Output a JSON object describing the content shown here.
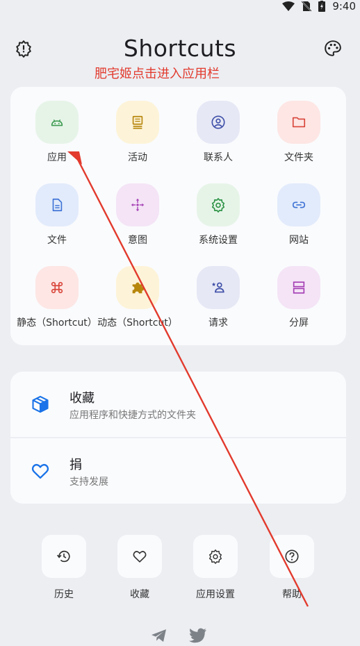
{
  "status_bar": {
    "time": "9:40"
  },
  "header": {
    "title": "Shortcuts"
  },
  "annotation": {
    "text": "肥宅姬点击进入应用栏"
  },
  "grid": {
    "items": [
      {
        "label": "应用",
        "icon": "android-icon",
        "bg": "#e6f4e8",
        "color": "#3d9a50"
      },
      {
        "label": "活动",
        "icon": "activity-icon",
        "bg": "#fdf3d8",
        "color": "#b7860b"
      },
      {
        "label": "联系人",
        "icon": "contact-icon",
        "bg": "#e6e8f5",
        "color": "#3f4fa8"
      },
      {
        "label": "文件夹",
        "icon": "folder-icon",
        "bg": "#fde6e4",
        "color": "#d9453a"
      },
      {
        "label": "文件",
        "icon": "file-icon",
        "bg": "#e2ebfb",
        "color": "#3f73d6"
      },
      {
        "label": "意图",
        "icon": "intent-icon",
        "bg": "#f4e4f6",
        "color": "#a43cb3"
      },
      {
        "label": "系统设置",
        "icon": "settings-icon",
        "bg": "#e6f4e8",
        "color": "#2f9447"
      },
      {
        "label": "网站",
        "icon": "link-icon",
        "bg": "#e2ebfb",
        "color": "#3f73d6"
      },
      {
        "label": "静态（Shortcut）",
        "icon": "command-icon",
        "bg": "#fde6e4",
        "color": "#d9453a"
      },
      {
        "label": "动态（Shortcut）",
        "icon": "puzzle-icon",
        "bg": "#fdf3d8",
        "color": "#b7860b"
      },
      {
        "label": "请求",
        "icon": "person-star-icon",
        "bg": "#e6e8f5",
        "color": "#3f4fa8"
      },
      {
        "label": "分屏",
        "icon": "split-screen-icon",
        "bg": "#f4e4f6",
        "color": "#a43cb3"
      }
    ]
  },
  "list": {
    "favorites": {
      "title": "收藏",
      "subtitle": "应用程序和快捷方式的文件夹",
      "icon": "box-icon"
    },
    "donate": {
      "title": "捐",
      "subtitle": "支持发展",
      "icon": "heart-icon"
    }
  },
  "bottom_nav": {
    "items": [
      {
        "label": "历史",
        "icon": "history-icon"
      },
      {
        "label": "收藏",
        "icon": "heart-icon"
      },
      {
        "label": "应用设置",
        "icon": "gear-icon"
      },
      {
        "label": "帮助",
        "icon": "help-icon"
      }
    ]
  },
  "social": {
    "telegram_icon": "telegram-icon",
    "twitter_icon": "twitter-icon"
  },
  "colors": {
    "accent": "#1a73e8",
    "annotation": "#e23a2d",
    "background": "#eceef2",
    "card": "#fafbfd"
  }
}
